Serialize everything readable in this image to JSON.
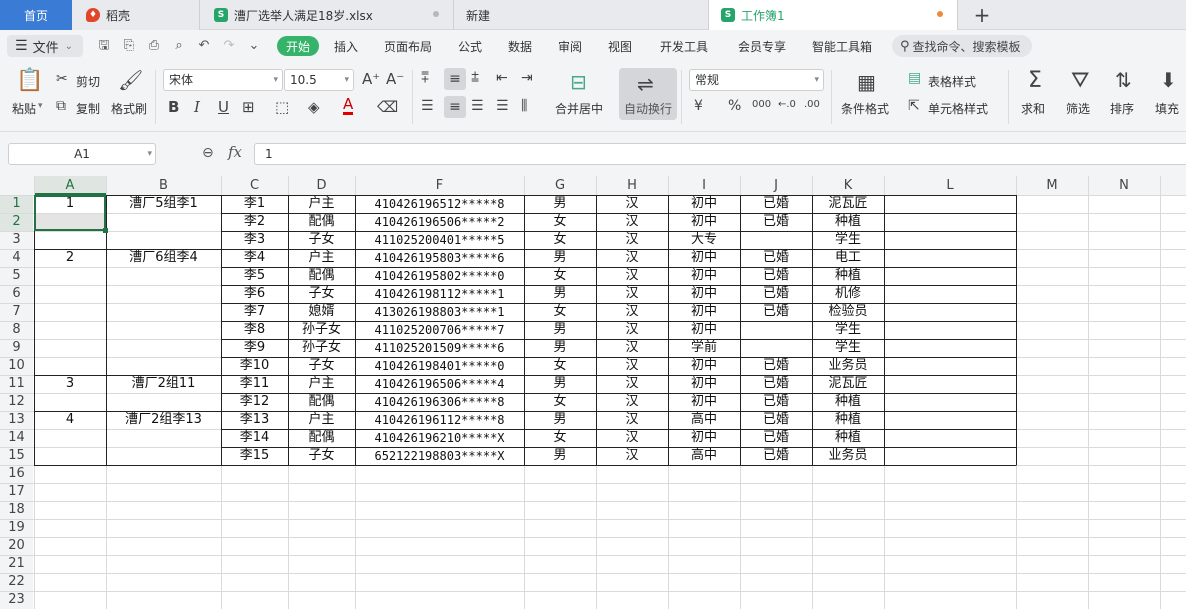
{
  "tabs": {
    "home": "首页",
    "daoke": "稻壳",
    "file1": "漕厂选举人满足18岁.xlsx",
    "new": "新建",
    "workbook": "工作簿1",
    "add": "+"
  },
  "menu": {
    "file": "文件",
    "start": "开始",
    "items": [
      "插入",
      "页面布局",
      "公式",
      "数据",
      "审阅",
      "视图",
      "开发工具",
      "会员专享",
      "智能工具箱"
    ],
    "search": "查找命令、搜索模板"
  },
  "ribbon": {
    "paste": "粘贴",
    "cut": "剪切",
    "copy": "复制",
    "format_painter": "格式刷",
    "font_name": "宋体",
    "font_size": "10.5",
    "merge_center": "合并居中",
    "wrap_text": "自动换行",
    "number_format": "常规",
    "conditional_format": "条件格式",
    "table_style": "表格样式",
    "cell_style": "单元格样式",
    "sum": "求和",
    "filter": "筛选",
    "sort": "排序",
    "fill": "填充"
  },
  "formula": {
    "cell_ref": "A1",
    "fx": "fx",
    "value": "1"
  },
  "sheet": {
    "columns": [
      "A",
      "B",
      "C",
      "D",
      "F",
      "G",
      "H",
      "I",
      "J",
      "K",
      "L",
      "M",
      "N"
    ],
    "rows": [
      "1",
      "2",
      "3",
      "4",
      "5",
      "6",
      "7",
      "8",
      "9",
      "10",
      "11",
      "12",
      "13",
      "14",
      "15",
      "16",
      "17",
      "18",
      "19",
      "20",
      "21",
      "22",
      "23"
    ],
    "data": [
      [
        "1",
        "漕厂5组李1",
        "李1",
        "户主",
        "410426196512*****8",
        "男",
        "汉",
        "初中",
        "已婚",
        "泥瓦匠"
      ],
      [
        "",
        "",
        "李2",
        "配偶",
        "410426196506*****2",
        "女",
        "汉",
        "初中",
        "已婚",
        "种植"
      ],
      [
        "",
        "",
        "李3",
        "子女",
        "411025200401*****5",
        "女",
        "汉",
        "大专",
        "",
        "学生"
      ],
      [
        "2",
        "漕厂6组李4",
        "李4",
        "户主",
        "410426195803*****6",
        "男",
        "汉",
        "初中",
        "已婚",
        "电工"
      ],
      [
        "",
        "",
        "李5",
        "配偶",
        "410426195802*****0",
        "女",
        "汉",
        "初中",
        "已婚",
        "种植"
      ],
      [
        "",
        "",
        "李6",
        "子女",
        "410426198112*****1",
        "男",
        "汉",
        "初中",
        "已婚",
        "机修"
      ],
      [
        "",
        "",
        "李7",
        "媳婿",
        "413026198803*****1",
        "女",
        "汉",
        "初中",
        "已婚",
        "检验员"
      ],
      [
        "",
        "",
        "李8",
        "孙子女",
        "411025200706*****7",
        "男",
        "汉",
        "初中",
        "",
        "学生"
      ],
      [
        "",
        "",
        "李9",
        "孙子女",
        "411025201509*****6",
        "男",
        "汉",
        "学前",
        "",
        "学生"
      ],
      [
        "",
        "",
        "李10",
        "子女",
        "410426198401*****0",
        "女",
        "汉",
        "初中",
        "已婚",
        "业务员"
      ],
      [
        "3",
        "漕厂2组11",
        "李11",
        "户主",
        "410426196506*****4",
        "男",
        "汉",
        "初中",
        "已婚",
        "泥瓦匠"
      ],
      [
        "",
        "",
        "李12",
        "配偶",
        "410426196306*****8",
        "女",
        "汉",
        "初中",
        "已婚",
        "种植"
      ],
      [
        "4",
        "漕厂2组李13",
        "李13",
        "户主",
        "410426196112*****8",
        "男",
        "汉",
        "高中",
        "已婚",
        "种植"
      ],
      [
        "",
        "",
        "李14",
        "配偶",
        "410426196210*****X",
        "女",
        "汉",
        "初中",
        "已婚",
        "种植"
      ],
      [
        "",
        "",
        "李15",
        "子女",
        "652122198803*****X",
        "男",
        "汉",
        "高中",
        "已婚",
        "业务员"
      ]
    ]
  },
  "colors": {
    "accent": "#35b36b",
    "selection": "#217346"
  }
}
